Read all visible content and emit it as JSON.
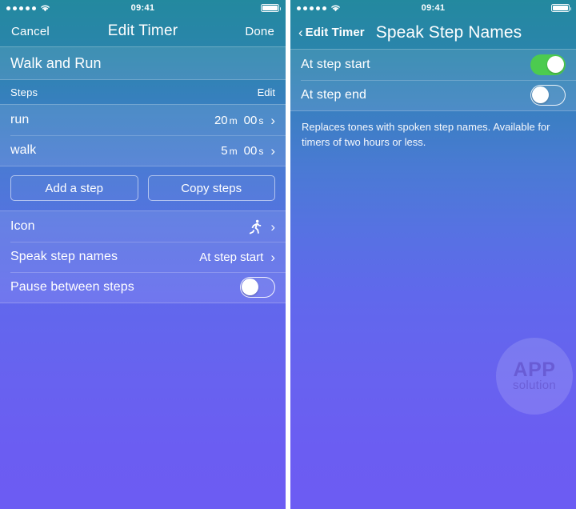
{
  "status_bar": {
    "signal_dots": 5,
    "wifi_icon": "wifi-icon",
    "time": "09:41",
    "battery_icon": "battery-full-icon"
  },
  "left_screen": {
    "nav": {
      "cancel_label": "Cancel",
      "title": "Edit Timer",
      "done_label": "Done"
    },
    "timer_name": "Walk and Run",
    "steps_section": {
      "header_label": "Steps",
      "edit_label": "Edit",
      "steps": [
        {
          "name": "run",
          "minutes": "20",
          "minutes_unit": "m",
          "seconds": "00",
          "seconds_unit": "s",
          "chevron": "chevron-right-icon"
        },
        {
          "name": "walk",
          "minutes": "5",
          "minutes_unit": "m",
          "seconds": "00",
          "seconds_unit": "s",
          "chevron": "chevron-right-icon"
        }
      ],
      "add_step_label": "Add a step",
      "copy_steps_label": "Copy steps"
    },
    "settings": {
      "icon_row": {
        "label": "Icon",
        "value_icon": "running-person-icon",
        "chevron": "chevron-right-icon"
      },
      "speak_row": {
        "label": "Speak step names",
        "value": "At step start",
        "chevron": "chevron-right-icon"
      },
      "pause_row": {
        "label": "Pause between steps",
        "toggle_state": "off"
      }
    }
  },
  "right_screen": {
    "nav": {
      "back_chevron": "chevron-left-icon",
      "back_label": "Edit Timer",
      "title": "Speak Step Names"
    },
    "options": [
      {
        "label": "At step start",
        "toggle_state": "on"
      },
      {
        "label": "At step end",
        "toggle_state": "off"
      }
    ],
    "footer_note": "Replaces tones with spoken step names. Available for timers of two hours or less.",
    "watermark": {
      "line1": "APP",
      "line2": "solution"
    }
  },
  "colors": {
    "gradient_top": "#23899f",
    "gradient_bottom": "#6c5cf3",
    "toggle_on": "#4ccb4f",
    "text": "#ffffff"
  }
}
